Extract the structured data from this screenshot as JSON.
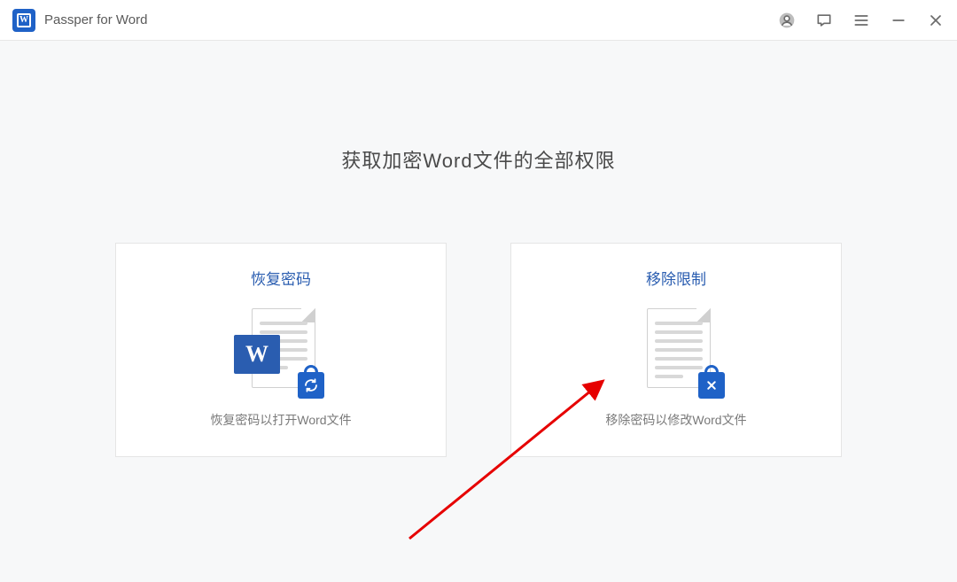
{
  "app": {
    "title": "Passper for Word",
    "logo_letter": "W"
  },
  "main": {
    "headline": "获取加密Word文件的全部权限"
  },
  "cards": {
    "recover": {
      "title": "恢复密码",
      "desc": "恢复密码以打开Word文件",
      "word_letter": "W"
    },
    "remove": {
      "title": "移除限制",
      "desc": "移除密码以修改Word文件"
    }
  }
}
